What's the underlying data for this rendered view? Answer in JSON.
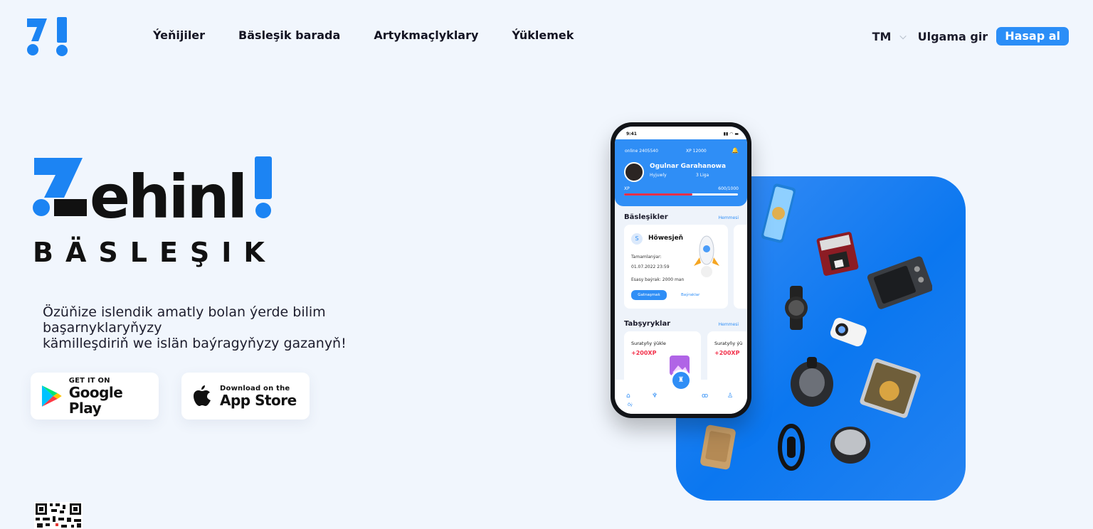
{
  "header": {
    "nav": [
      "Ýeňijiler",
      "Bäsleşik barada",
      "Artykmaçlyklary",
      "Ýüklemek"
    ],
    "lang": "TM",
    "login": "Ulgama gir",
    "signup": "Hasap al"
  },
  "hero": {
    "logo_word": "Zehinli",
    "logo_sub": "BÄSLEŞIK",
    "tagline_line1": "Özüňize islendik amatly bolan ýerde bilim başarnyklaryňyzy",
    "tagline_line2": "kämilleşdiriň we islän baýragyňyzy gazanyň!",
    "google": {
      "small": "GET IT ON",
      "big": "Google Play"
    },
    "apple": {
      "small": "Download on the",
      "big": "App Store"
    }
  },
  "phone": {
    "time": "9:41",
    "online": "online 2405540",
    "xp": "XP 12000",
    "name": "Ogulnar Garahanowa",
    "level": "Hyjuwly",
    "liga": "3 Liga",
    "xp_label": "XP",
    "xp_value": "600/1000",
    "xp_progress": 0.6,
    "section1": "Bäsleşikler",
    "see_all": "Hemmesi",
    "card_title": "Höwesjeň",
    "card_done": "Tamamlanýar:",
    "card_date": "01.07.2022   23:59",
    "card_prize": "Esasy baýrak:  2000 man",
    "card_btn": "Gatnaşmak",
    "card_link": "Baýraklar",
    "section2": "Tabşyryklar",
    "task_title": "Suratyňy ýükle",
    "task_title2": "Suratyňy ýü",
    "task_xp": "+200XP",
    "home_label": "Öý"
  },
  "colors": {
    "accent": "#2b8ef7",
    "panel": "#0b77f0",
    "dot": "#1c84f3",
    "xp_bar": "#f2304a"
  }
}
